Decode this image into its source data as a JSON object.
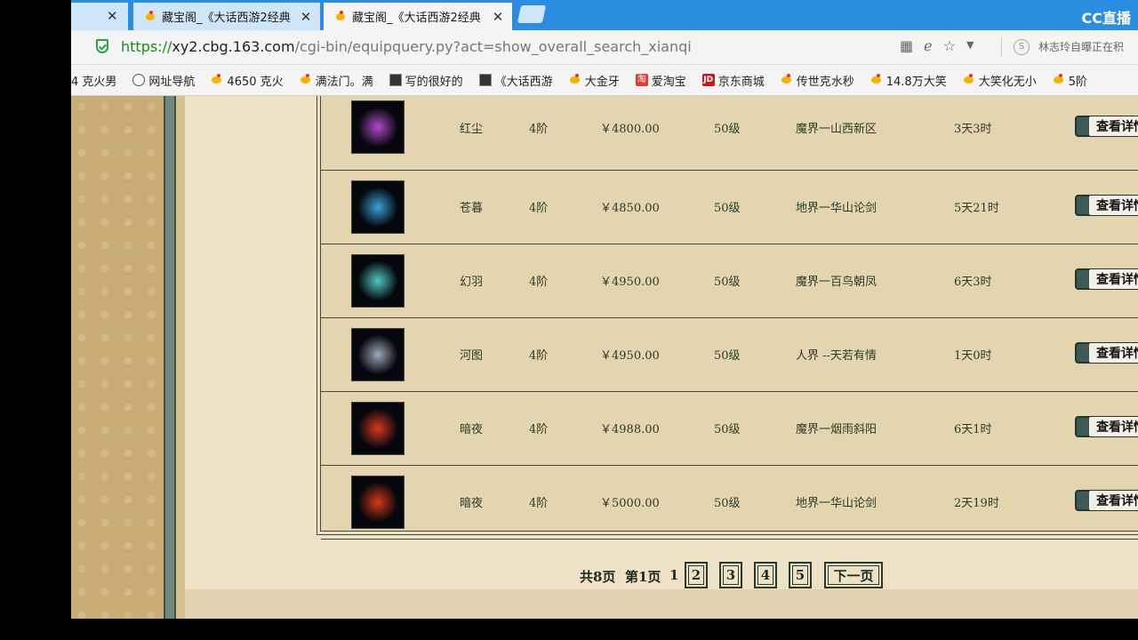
{
  "tabs": [
    {
      "title": "藏宝阁_《大话西游2经典",
      "active": false
    },
    {
      "title": "藏宝阁_《大话西游2经典",
      "active": true
    }
  ],
  "brand": "CC直播",
  "url": {
    "scheme": "https://",
    "host": "xy2.cbg.163.com",
    "path": "/cgi-bin/equipquery.py?act=show_overall_search_xianqi"
  },
  "news": "林志玲自曝正在积",
  "bookmarks": [
    {
      "label": "4 克火男",
      "icon": "none"
    },
    {
      "label": "网址导航",
      "icon": "globe-icon"
    },
    {
      "label": "4650 克火",
      "icon": "yellow-icon"
    },
    {
      "label": "满法门。满",
      "icon": "yellow-icon"
    },
    {
      "label": "写的很好的",
      "icon": "dark-icon"
    },
    {
      "label": "《大话西游",
      "icon": "dark-icon"
    },
    {
      "label": "大金牙",
      "icon": "yellow-icon"
    },
    {
      "label": "爱淘宝",
      "icon": "taobao-icon"
    },
    {
      "label": "京东商城",
      "icon": "jd-icon"
    },
    {
      "label": "传世克水秒",
      "icon": "yellow-icon"
    },
    {
      "label": "14.8万大笑",
      "icon": "yellow-icon"
    },
    {
      "label": "大笑化无小",
      "icon": "yellow-icon"
    },
    {
      "label": "5阶",
      "icon": "yellow-icon"
    }
  ],
  "items": [
    {
      "name": "红尘",
      "tier": "4阶",
      "price": "￥4800.00",
      "level": "50级",
      "server": "魔界一山西新区",
      "time": "3天3时",
      "button": "查看详情",
      "thumb_color": "#b04ac8"
    },
    {
      "name": "苍暮",
      "tier": "4阶",
      "price": "￥4850.00",
      "level": "50级",
      "server": "地界一华山论剑",
      "time": "5天21时",
      "button": "查看详情",
      "thumb_color": "#3aa0d8"
    },
    {
      "name": "幻羽",
      "tier": "4阶",
      "price": "￥4950.00",
      "level": "50级",
      "server": "魔界一百鸟朝凤",
      "time": "6天3时",
      "button": "查看详情",
      "thumb_color": "#4fc8c0"
    },
    {
      "name": "河图",
      "tier": "4阶",
      "price": "￥4950.00",
      "level": "50级",
      "server": "人界 --天若有情",
      "time": "1天0时",
      "button": "查看详情",
      "thumb_color": "#9aa8b8"
    },
    {
      "name": "暗夜",
      "tier": "4阶",
      "price": "￥4988.00",
      "level": "50级",
      "server": "魔界一烟雨斜阳",
      "time": "6天1时",
      "button": "查看详情",
      "thumb_color": "#d8381c"
    },
    {
      "name": "暗夜",
      "tier": "4阶",
      "price": "￥5000.00",
      "level": "50级",
      "server": "地界一华山论剑",
      "time": "2天19时",
      "button": "查看详情",
      "thumb_color": "#d8381c"
    }
  ],
  "pager": {
    "total": "共8页",
    "current": "第1页",
    "current_num": "1",
    "pages": [
      "2",
      "3",
      "4",
      "5"
    ],
    "next": "下一页"
  }
}
